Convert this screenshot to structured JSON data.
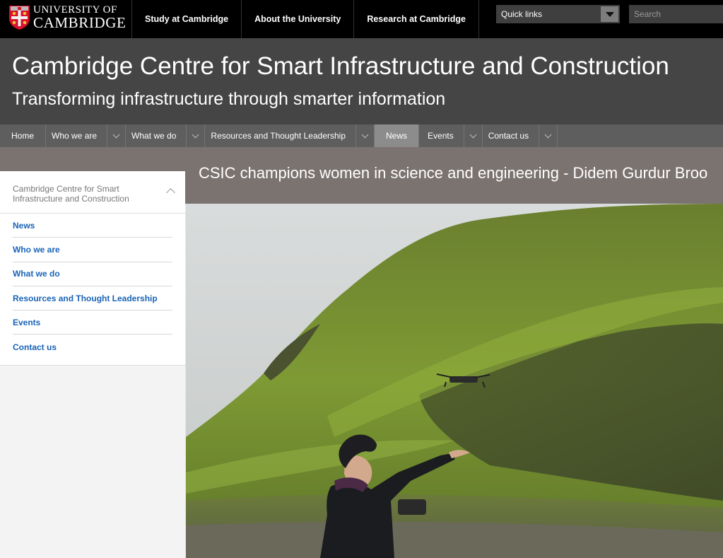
{
  "brand": {
    "line1": "UNIVERSITY OF",
    "line2": "CAMBRIDGE"
  },
  "top_nav": [
    {
      "label": "Study at Cambridge"
    },
    {
      "label": "About the University"
    },
    {
      "label": "Research at Cambridge"
    }
  ],
  "quick_links": {
    "label": "Quick links",
    "icon": "caret-down-icon"
  },
  "search": {
    "placeholder": "Search"
  },
  "site": {
    "title": "Cambridge Centre for Smart Infrastructure and Construction",
    "tagline": "Transforming infrastructure through smarter information"
  },
  "main_nav": [
    {
      "label": "Home",
      "has_dropdown": false,
      "active": false
    },
    {
      "label": "Who we are",
      "has_dropdown": true,
      "active": false
    },
    {
      "label": "What we do",
      "has_dropdown": true,
      "active": false
    },
    {
      "label": "Resources and Thought Leadership",
      "has_dropdown": true,
      "active": false
    },
    {
      "label": "News",
      "has_dropdown": false,
      "active": true
    },
    {
      "label": "Events",
      "has_dropdown": true,
      "active": false
    },
    {
      "label": "Contact us",
      "has_dropdown": true,
      "active": false
    }
  ],
  "article": {
    "title": "CSIC champions women in science and engineering - Didem Gurdur Broo"
  },
  "sidebar": {
    "header": "Cambridge Centre for Smart Infrastructure and Construction",
    "items": [
      {
        "label": "News"
      },
      {
        "label": "Who we are"
      },
      {
        "label": "What we do"
      },
      {
        "label": "Resources and Thought Leadership"
      },
      {
        "label": "Events"
      },
      {
        "label": "Contact us"
      }
    ]
  },
  "colors": {
    "topbar": "#000000",
    "header": "#454545",
    "nav": "#5e5e5e",
    "nav_active": "#8c8c8c",
    "title_band": "#7b7370",
    "link": "#1a63b6"
  }
}
